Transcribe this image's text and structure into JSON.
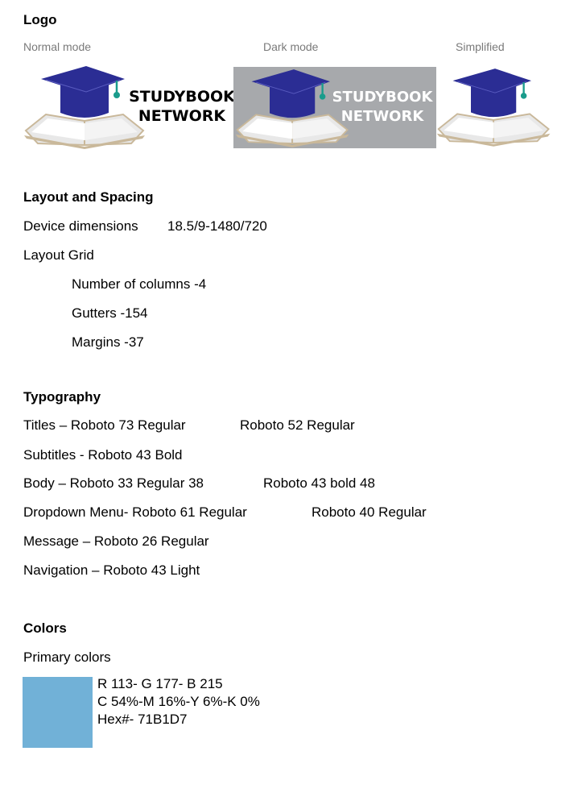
{
  "logo": {
    "heading": "Logo",
    "variants": [
      {
        "caption": "Normal mode",
        "text_line1": "STUDYBOOK",
        "text_line2": "NETWORK",
        "text_color": "#000000",
        "bg_color": "#ffffff"
      },
      {
        "caption": "Dark mode",
        "text_line1": "STUDYBOOK",
        "text_line2": "NETWORK",
        "text_color": "#ffffff",
        "bg_color": "#a7a9ac"
      },
      {
        "caption": "Simplified"
      }
    ],
    "cap_color": "#2b2d94",
    "tassel_color": "#1a9c8c"
  },
  "layout": {
    "heading": "Layout and Spacing",
    "device_label": "Device dimensions",
    "device_value": "18.5/9-1480/720",
    "grid_label": "Layout Grid",
    "columns": "Number of columns -4",
    "gutters": "Gutters -154",
    "margins": "Margins -37"
  },
  "typography": {
    "heading": "Typography",
    "titles_a": "Titles – Roboto 73 Regular",
    "titles_b": "Roboto 52 Regular",
    "subtitles": "Subtitles - Roboto 43 Bold",
    "body_a": "Body – Roboto 33 Regular 38",
    "body_b": "Roboto 43 bold 48",
    "dropdown_a": "Dropdown Menu- Roboto 61 Regular",
    "dropdown_b": "Roboto 40 Regular",
    "message": "Message – Roboto 26 Regular",
    "navigation": "Navigation – Roboto 43 Light"
  },
  "colors": {
    "heading": "Colors",
    "primary_label": "Primary colors",
    "swatch_color": "#71B1D7",
    "rgb": "R 113- G 177- B 215",
    "cmyk": "C 54%-M 16%-Y 6%-K 0%",
    "hex": "Hex#- 71B1D7"
  }
}
